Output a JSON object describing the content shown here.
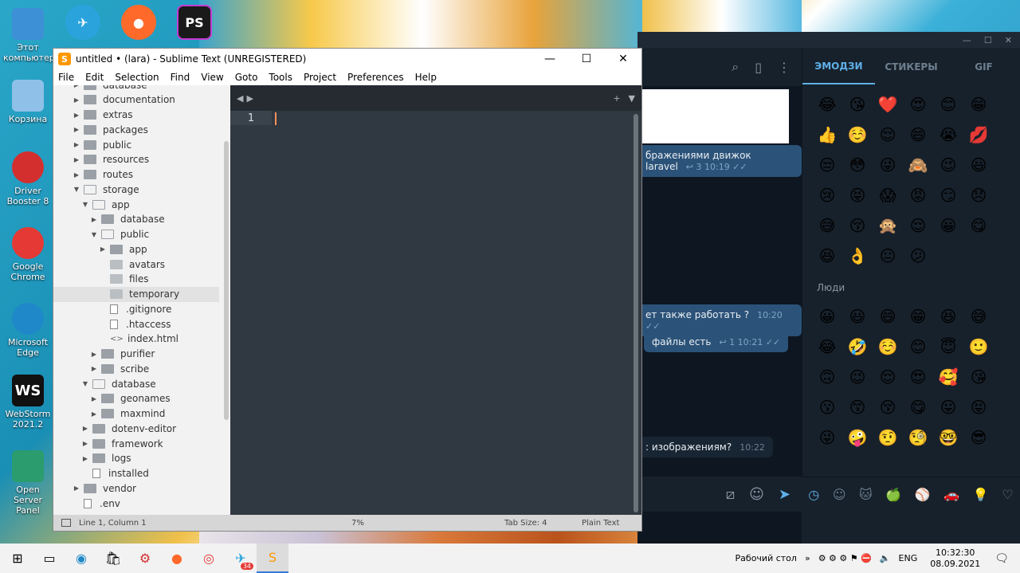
{
  "desktop": {
    "icons": [
      {
        "label": "Этот компьютер",
        "icon": "computer-icon"
      },
      {
        "label": "Корзина",
        "icon": "recycle-bin-icon"
      },
      {
        "label": "Driver Booster 8",
        "icon": "driver-booster-icon"
      },
      {
        "label": "Google Chrome",
        "icon": "chrome-icon"
      },
      {
        "label": "Microsoft Edge",
        "icon": "edge-icon"
      },
      {
        "label": "WebStorm 2021.2",
        "icon": "webstorm-icon"
      },
      {
        "label": "Open Server Panel",
        "icon": "open-server-icon"
      }
    ],
    "top_icons": [
      "telegram-icon",
      "firefox-icon",
      "phpstorm-icon"
    ],
    "phpstorm_label": "PS",
    "webstorm_label": "WS"
  },
  "sublime": {
    "title": "untitled • (lara) - Sublime Text (UNREGISTERED)",
    "logo": "S",
    "menu": [
      "File",
      "Edit",
      "Selection",
      "Find",
      "View",
      "Goto",
      "Tools",
      "Project",
      "Preferences",
      "Help"
    ],
    "tree": [
      {
        "label": "database",
        "type": "folder",
        "level": 0,
        "open": false
      },
      {
        "label": "documentation",
        "type": "folder",
        "level": 0,
        "open": false
      },
      {
        "label": "extras",
        "type": "folder",
        "level": 0,
        "open": false
      },
      {
        "label": "packages",
        "type": "folder",
        "level": 0,
        "open": false
      },
      {
        "label": "public",
        "type": "folder",
        "level": 0,
        "open": false
      },
      {
        "label": "resources",
        "type": "folder",
        "level": 0,
        "open": false
      },
      {
        "label": "routes",
        "type": "folder",
        "level": 0,
        "open": false
      },
      {
        "label": "storage",
        "type": "folder",
        "level": 0,
        "open": true
      },
      {
        "label": "app",
        "type": "folder",
        "level": 1,
        "open": true
      },
      {
        "label": "database",
        "type": "folder",
        "level": 2,
        "open": false
      },
      {
        "label": "public",
        "type": "folder",
        "level": 2,
        "open": true
      },
      {
        "label": "app",
        "type": "folder",
        "level": 3,
        "open": false
      },
      {
        "label": "avatars",
        "type": "link",
        "level": 3
      },
      {
        "label": "files",
        "type": "link",
        "level": 3
      },
      {
        "label": "temporary",
        "type": "link",
        "level": 3,
        "selected": true
      },
      {
        "label": ".gitignore",
        "type": "file",
        "level": 3
      },
      {
        "label": ".htaccess",
        "type": "file",
        "level": 3
      },
      {
        "label": "index.html",
        "type": "code",
        "level": 3
      },
      {
        "label": "purifier",
        "type": "folder",
        "level": 2,
        "open": false
      },
      {
        "label": "scribe",
        "type": "folder",
        "level": 2,
        "open": false
      },
      {
        "label": "database",
        "type": "folder",
        "level": 1,
        "open": true
      },
      {
        "label": "geonames",
        "type": "folder",
        "level": 2,
        "open": false
      },
      {
        "label": "maxmind",
        "type": "folder",
        "level": 2,
        "open": false
      },
      {
        "label": "dotenv-editor",
        "type": "folder",
        "level": 1,
        "open": false
      },
      {
        "label": "framework",
        "type": "folder",
        "level": 1,
        "open": false
      },
      {
        "label": "logs",
        "type": "folder",
        "level": 1,
        "open": false
      },
      {
        "label": "installed",
        "type": "file",
        "level": 1
      },
      {
        "label": "vendor",
        "type": "folder",
        "level": 0,
        "open": false
      },
      {
        "label": ".env",
        "type": "file",
        "level": 0
      }
    ],
    "line_number": "1",
    "status": {
      "position": "Line 1, Column 1",
      "percent": "7%",
      "tab_size": "Tab Size: 4",
      "syntax": "Plain Text"
    }
  },
  "telegram": {
    "tabs": [
      "ЭМОДЗИ",
      "СТИКЕРЫ",
      "GIF"
    ],
    "messages": [
      {
        "text": "бражениями  движок laravel",
        "replies": "3",
        "time": "10:19",
        "out": true
      },
      {
        "text": "ет также работать ?",
        "time": "10:20",
        "out": true
      },
      {
        "text": "файлы есть",
        "replies": "1",
        "time": "10:21",
        "out": true
      },
      {
        "text": "0:22",
        "out": false
      },
      {
        "text": ": изображениям?",
        "time": "10:22",
        "out": false
      }
    ],
    "emoji_recent": [
      "😂",
      "😘",
      "❤️",
      "😍",
      "😊",
      "😁",
      "👍",
      "☺️",
      "😌",
      "😄",
      "😭",
      "💋",
      "😒",
      "😳",
      "😜",
      "🙈",
      "😉",
      "😃",
      "😢",
      "😝",
      "😱",
      "😡",
      "😏",
      "😞",
      "😅",
      "😚",
      "🙊",
      "😌",
      "😀",
      "😋",
      "😆",
      "👌",
      "😐",
      "😕"
    ],
    "people_label": "Люди",
    "emoji_people": [
      "😀",
      "😃",
      "😄",
      "😁",
      "😆",
      "😅",
      "😂",
      "🤣",
      "☺️",
      "😊",
      "😇",
      "🙂",
      "🙃",
      "😉",
      "😌",
      "😍",
      "🥰",
      "😘",
      "😗",
      "😙",
      "😚",
      "😋",
      "😛",
      "😝",
      "😜",
      "🤪",
      "🤨",
      "🧐",
      "🤓",
      "😎"
    ]
  },
  "taskbar": {
    "telegram_badge": "34",
    "desktop_label": "Рабочий стол",
    "lang": "ENG",
    "time": "10:32:30",
    "date": "08.09.2021"
  }
}
